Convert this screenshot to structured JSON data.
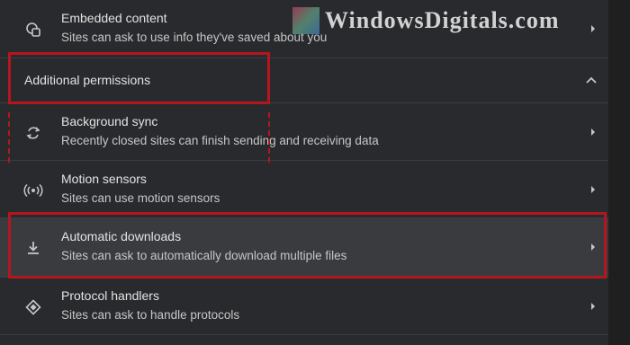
{
  "watermark": {
    "text": "WindowsDigitals.com"
  },
  "embedded": {
    "title": "Embedded content",
    "desc": "Sites can ask to use info they've saved about you",
    "icon": "embedded-content-icon"
  },
  "section": {
    "label": "Additional permissions",
    "icon": "chevron-up-icon"
  },
  "rows": [
    {
      "title": "Background sync",
      "desc": "Recently closed sites can finish sending and receiving data",
      "icon": "sync-icon"
    },
    {
      "title": "Motion sensors",
      "desc": "Sites can use motion sensors",
      "icon": "sensors-icon"
    },
    {
      "title": "Automatic downloads",
      "desc": "Sites can ask to automatically download multiple files",
      "icon": "download-icon"
    },
    {
      "title": "Protocol handlers",
      "desc": "Sites can ask to handle protocols",
      "icon": "protocol-handler-icon"
    }
  ],
  "colors": {
    "highlight": "#b5161e",
    "panel": "#292a2d",
    "text": "#e3e3e3"
  }
}
